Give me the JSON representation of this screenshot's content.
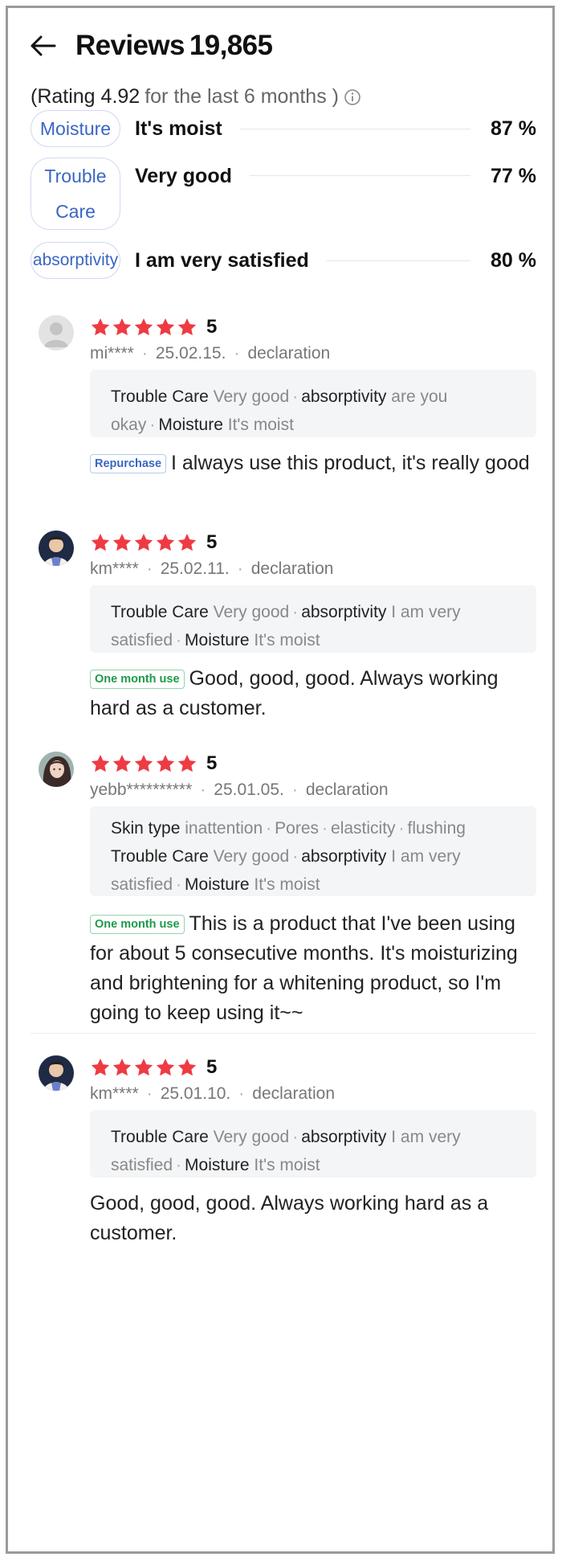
{
  "header": {
    "title": "Reviews",
    "count": "19,865"
  },
  "rating": {
    "prefix": "(Rating 4.92",
    "suffix": "for the last 6 months )"
  },
  "summary": [
    {
      "chip": "Moisture",
      "label": "It's moist",
      "pct": "87 %"
    },
    {
      "chip": "Trouble Care",
      "label": "Very good",
      "pct": "77 %"
    },
    {
      "chip": "absorptivity",
      "label": "I am very satisfied",
      "pct": "80 %"
    }
  ],
  "reviews": [
    {
      "score": "5",
      "user": "mi****",
      "date": "25.02.15.",
      "tag": "declaration",
      "badge": "Repurchase",
      "badge_color": "#3a66c4",
      "attrs": {
        "k1": "Trouble Care",
        "v1": "Very good",
        "k2": "absorptivity",
        "v2": "are you okay",
        "k3": "Moisture",
        "v3": "It's moist"
      },
      "text": "I always use this product, it's really good"
    },
    {
      "score": "5",
      "user": "km****",
      "date": "25.02.11.",
      "tag": "declaration",
      "badge": "One month use",
      "badge_color": "#1e9a4a",
      "attrs": {
        "k1": "Trouble Care",
        "v1": "Very good",
        "k2": "absorptivity",
        "v2": "I am very satisfied",
        "k3": "Moisture",
        "v3": "It's moist"
      },
      "text": "Good, good, good. Always working hard as a customer."
    },
    {
      "score": "5",
      "user": "yebb**********",
      "date": "25.01.05.",
      "tag": "declaration",
      "badge": "One month use",
      "badge_color": "#1e9a4a",
      "attrs": {
        "k0": "Skin type",
        "v0a": "inattention",
        "v0b": "Pores",
        "v0c": "elasticity",
        "v0d": "flushing",
        "k1": "Trouble Care",
        "v1": "Very good",
        "k2": "absorptivity",
        "v2": "I am very satisfied",
        "k3": "Moisture",
        "v3": "It's moist"
      },
      "text": "This is a product that I've been using for about 5 consecutive months. It's moisturizing and brightening for a whitening product, so I'm going to keep using it~~"
    },
    {
      "score": "5",
      "user": "km****",
      "date": "25.01.10.",
      "tag": "declaration",
      "attrs": {
        "k1": "Trouble Care",
        "v1": "Very good",
        "k2": "absorptivity",
        "v2": "I am very satisfied",
        "k3": "Moisture",
        "v3": "It's moist"
      },
      "text": "Good, good, good. Always working hard as a customer."
    }
  ],
  "colors": {
    "star": "#ee3b43",
    "chip_text": "#3a66c4"
  }
}
